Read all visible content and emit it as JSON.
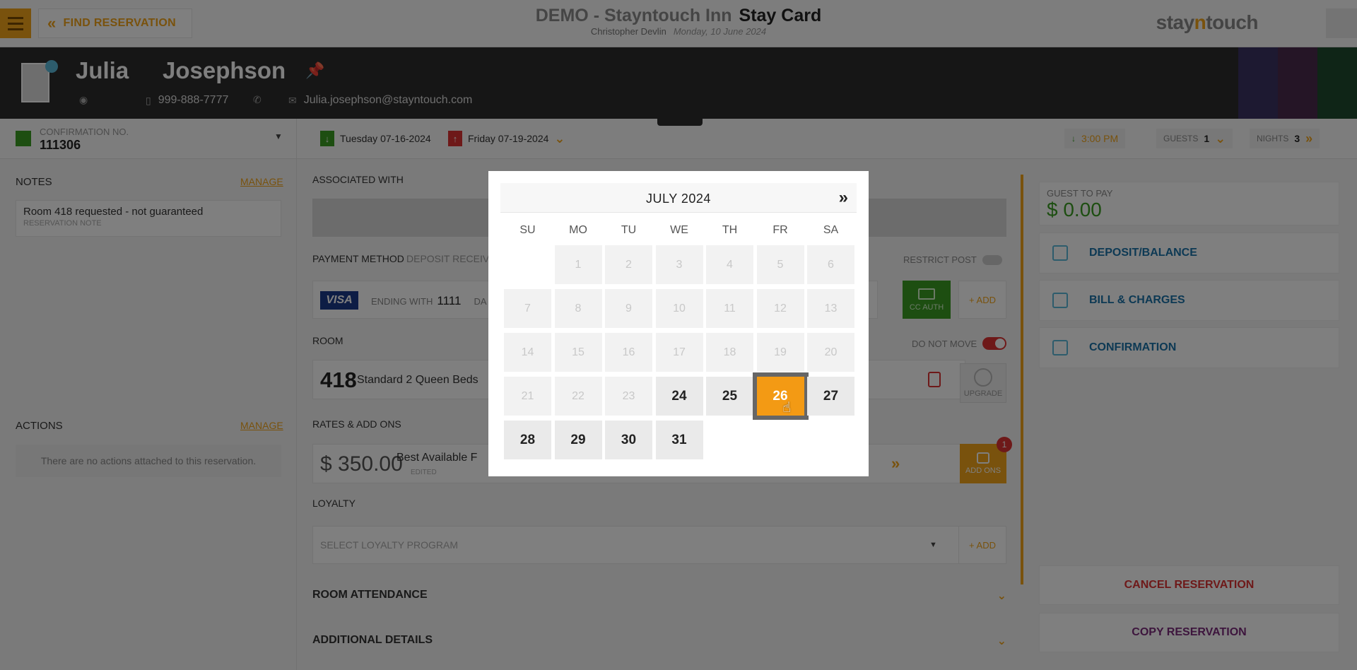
{
  "topbar": {
    "find_reservation": "FIND RESERVATION",
    "hotel": "DEMO - Stayntouch Inn",
    "page_title": "Stay Card",
    "user": "Christopher Devlin",
    "date": "Monday, 10 June 2024",
    "brand_a": "stay",
    "brand_n": "n",
    "brand_b": "touch"
  },
  "guest": {
    "first_name": "Julia",
    "last_name": "Josephson",
    "phone": "999-888-7777",
    "email": "Julia.josephson@stayntouch.com"
  },
  "subbar": {
    "confirmation_label": "CONFIRMATION NO.",
    "confirmation_number": "111306",
    "arrival": "Tuesday 07-16-2024",
    "departure": "Friday 07-19-2024",
    "arrival_time": "3:00 PM",
    "guests_label": "GUESTS",
    "guests": "1",
    "nights_label": "NIGHTS",
    "nights": "3"
  },
  "left": {
    "notes_label": "NOTES",
    "manage": "MANAGE",
    "note_text": "Room 418 requested - not guaranteed",
    "note_sub": "RESERVATION NOTE",
    "actions_label": "ACTIONS",
    "actions_empty": "There are no actions attached to this reservation."
  },
  "center": {
    "associated_label": "ASSOCIATED WITH",
    "payment_label": "PAYMENT METHOD",
    "deposit_label": "DEPOSIT RECEIVE",
    "restrict_post": "RESTRICT POST",
    "card_brand": "VISA",
    "ending_with": "ENDING WITH",
    "card_last4": "1111",
    "exp_trunc": "DA",
    "cc_auth": "CC AUTH",
    "add": "+ ADD",
    "room_label": "ROOM",
    "do_not_move": "DO NOT MOVE",
    "room_number": "418",
    "room_type": "Standard 2 Queen Beds",
    "upgrade": "UPGRADE",
    "rates_label": "RATES & ADD ONS",
    "rate_amount": "$ 350.00",
    "rate_name": "Best Available F",
    "rate_edited": "EDITED",
    "addons_label": "ADD ONS",
    "addons_count": "1",
    "loyalty_label": "LOYALTY",
    "loyalty_placeholder": "SELECT LOYALTY PROGRAM",
    "room_attendance": "ROOM ATTENDANCE",
    "additional_details": "ADDITIONAL DETAILS"
  },
  "right": {
    "guest_to_pay_label": "GUEST TO PAY",
    "guest_to_pay": "$ 0.00",
    "deposit_balance": "DEPOSIT/BALANCE",
    "bill_charges": "BILL & CHARGES",
    "confirmation": "CONFIRMATION",
    "cancel_reservation": "CANCEL RESERVATION",
    "copy_reservation": "COPY RESERVATION"
  },
  "calendar": {
    "title": "JULY 2024",
    "next": "»",
    "weekdays": [
      "SU",
      "MO",
      "TU",
      "WE",
      "TH",
      "FR",
      "SA"
    ],
    "selected_day": "26",
    "days": [
      [
        "",
        "1",
        "2",
        "3",
        "4",
        "5",
        "6"
      ],
      [
        "7",
        "8",
        "9",
        "10",
        "11",
        "12",
        "13"
      ],
      [
        "14",
        "15",
        "16",
        "17",
        "18",
        "19",
        "20"
      ],
      [
        "21",
        "22",
        "23",
        "24",
        "25",
        "26",
        "27"
      ],
      [
        "28",
        "29",
        "30",
        "31",
        "",
        "",
        ""
      ]
    ],
    "first_enabled_day": 24
  },
  "colors": {
    "accent": "#f2a51a",
    "selected": "#f39a14",
    "green": "#3a9d23",
    "red": "#dd3333",
    "link_blue": "#1a72a8"
  }
}
